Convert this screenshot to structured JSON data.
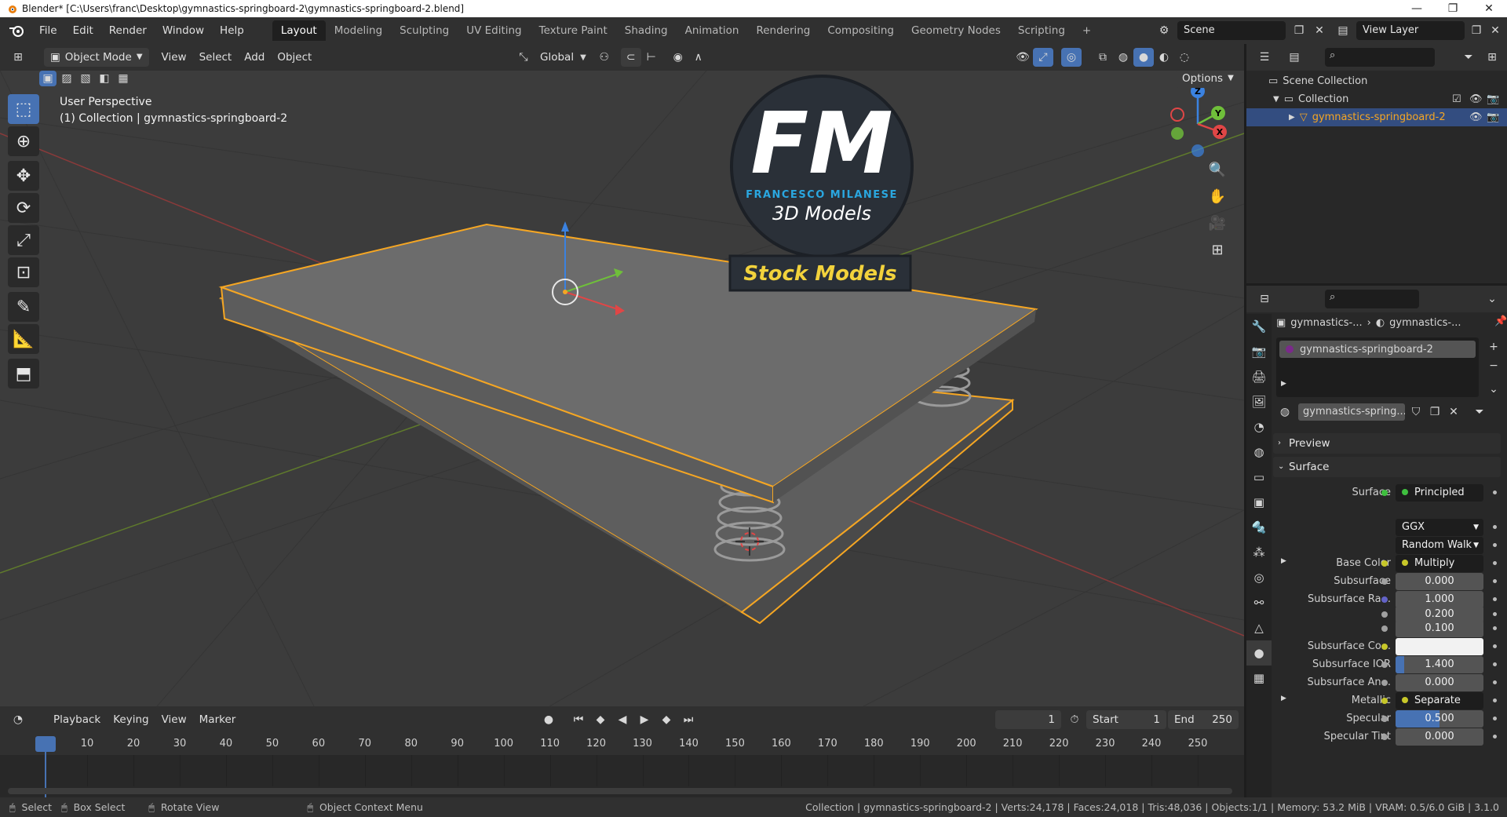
{
  "window": {
    "title": "Blender* [C:\\Users\\franc\\Desktop\\gymnastics-springboard-2\\gymnastics-springboard-2.blend]",
    "minimize": "—",
    "maximize": "❐",
    "close": "✕"
  },
  "menus": [
    "File",
    "Edit",
    "Render",
    "Window",
    "Help"
  ],
  "workspaces": [
    "Layout",
    "Modeling",
    "Sculpting",
    "UV Editing",
    "Texture Paint",
    "Shading",
    "Animation",
    "Rendering",
    "Compositing",
    "Geometry Nodes",
    "Scripting"
  ],
  "add_workspace": "+",
  "scene_field": "Scene",
  "view_layer_field": "View Layer",
  "viewport_header": {
    "mode": "Object Mode",
    "menus": [
      "View",
      "Select",
      "Add",
      "Object"
    ],
    "transform_orientation": "Global",
    "options": "Options"
  },
  "viewport": {
    "perspective": "User Perspective",
    "collection_info": "(1) Collection | gymnastics-springboard-2",
    "watermark_letters": "FM",
    "watermark_name": "FRANCESCO MILANESE",
    "watermark_sub": "3D Models",
    "watermark_banner": "Stock Models",
    "gizmo_labels": {
      "z": "Z",
      "y": "Y",
      "x": "X"
    }
  },
  "timeline": {
    "menus": [
      "Playback",
      "Keying",
      "View",
      "Marker"
    ],
    "current_frame": "1",
    "start_label": "Start",
    "start": "1",
    "end_label": "End",
    "end": "250",
    "frames": [
      "1",
      "10",
      "20",
      "30",
      "40",
      "50",
      "60",
      "70",
      "80",
      "90",
      "100",
      "110",
      "120",
      "130",
      "140",
      "150",
      "160",
      "170",
      "180",
      "190",
      "200",
      "210",
      "220",
      "230",
      "240",
      "250"
    ]
  },
  "outliner": {
    "scene_collection": "Scene Collection",
    "collection": "Collection",
    "object": "gymnastics-springboard-2"
  },
  "properties": {
    "breadcrumb_1": "gymnastics-...",
    "breadcrumb_2": "gymnastics-...",
    "material_slot": "gymnastics-springboard-2",
    "material_name": "gymnastics-spring...",
    "preview": "Preview",
    "surface_section": "Surface",
    "rows": [
      {
        "label": "Surface",
        "value": "Principled BSDF",
        "kind": "node",
        "dot": "#3fbf3f"
      },
      {
        "label": "",
        "value": "GGX",
        "kind": "dropdown"
      },
      {
        "label": "",
        "value": "Random Walk",
        "kind": "dropdown"
      },
      {
        "label": "Base Color",
        "value": "Multiply",
        "kind": "node",
        "dot": "#c7c729"
      },
      {
        "label": "Subsurface",
        "value": "0.000",
        "kind": "num",
        "fill": 0
      },
      {
        "label": "Subsurface Ra...",
        "value": "1.000",
        "kind": "num",
        "fill": 0,
        "dot": "#6363c7"
      },
      {
        "label": "",
        "value": "0.200",
        "kind": "num",
        "fill": 0
      },
      {
        "label": "",
        "value": "0.100",
        "kind": "num",
        "fill": 0
      },
      {
        "label": "Subsurface Co...",
        "value": "",
        "kind": "color",
        "dot": "#c7c729"
      },
      {
        "label": "Subsurface IOR",
        "value": "1.400",
        "kind": "num",
        "fill": 0.1
      },
      {
        "label": "Subsurface An...",
        "value": "0.000",
        "kind": "num",
        "fill": 0
      },
      {
        "label": "Metallic",
        "value": "Separate RGB",
        "kind": "node",
        "dot": "#c7c729"
      },
      {
        "label": "Specular",
        "value": "0.500",
        "kind": "num",
        "fill": 0.5
      },
      {
        "label": "Specular Tint",
        "value": "0.000",
        "kind": "num",
        "fill": 0
      }
    ]
  },
  "status": {
    "select": "Select",
    "box_select": "Box Select",
    "rotate_view": "Rotate View",
    "context_menu": "Object Context Menu",
    "stats": "Collection | gymnastics-springboard-2 | Verts:24,178 | Faces:24,018 | Tris:48,036 | Objects:1/1 | Memory: 53.2 MiB | VRAM: 0.5/6.0 GiB | 3.1.0"
  },
  "colors": {
    "accent": "#4772b3",
    "selection_outline": "#f5a623",
    "watermark_blue": "#2aa7e0",
    "banner_text": "#f2d23c"
  }
}
